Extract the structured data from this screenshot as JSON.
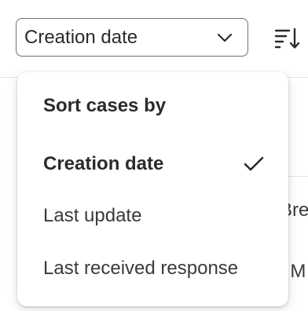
{
  "sort_select": {
    "value": "Creation date",
    "chevron_icon": "chevron-down-icon"
  },
  "sort_direction": {
    "icon": "sort-descending-icon"
  },
  "menu": {
    "heading": "Sort cases by",
    "items": [
      {
        "label": "Creation date",
        "selected": true
      },
      {
        "label": "Last update",
        "selected": false
      },
      {
        "label": "Last received response",
        "selected": false
      }
    ],
    "selected_icon": "checkmark-icon"
  },
  "background": {
    "fragments": [
      "Bre",
      ". M"
    ]
  },
  "colors": {
    "text": "#2b2b2b",
    "border": "#6f6f6f",
    "divider": "#e4e4e4"
  }
}
